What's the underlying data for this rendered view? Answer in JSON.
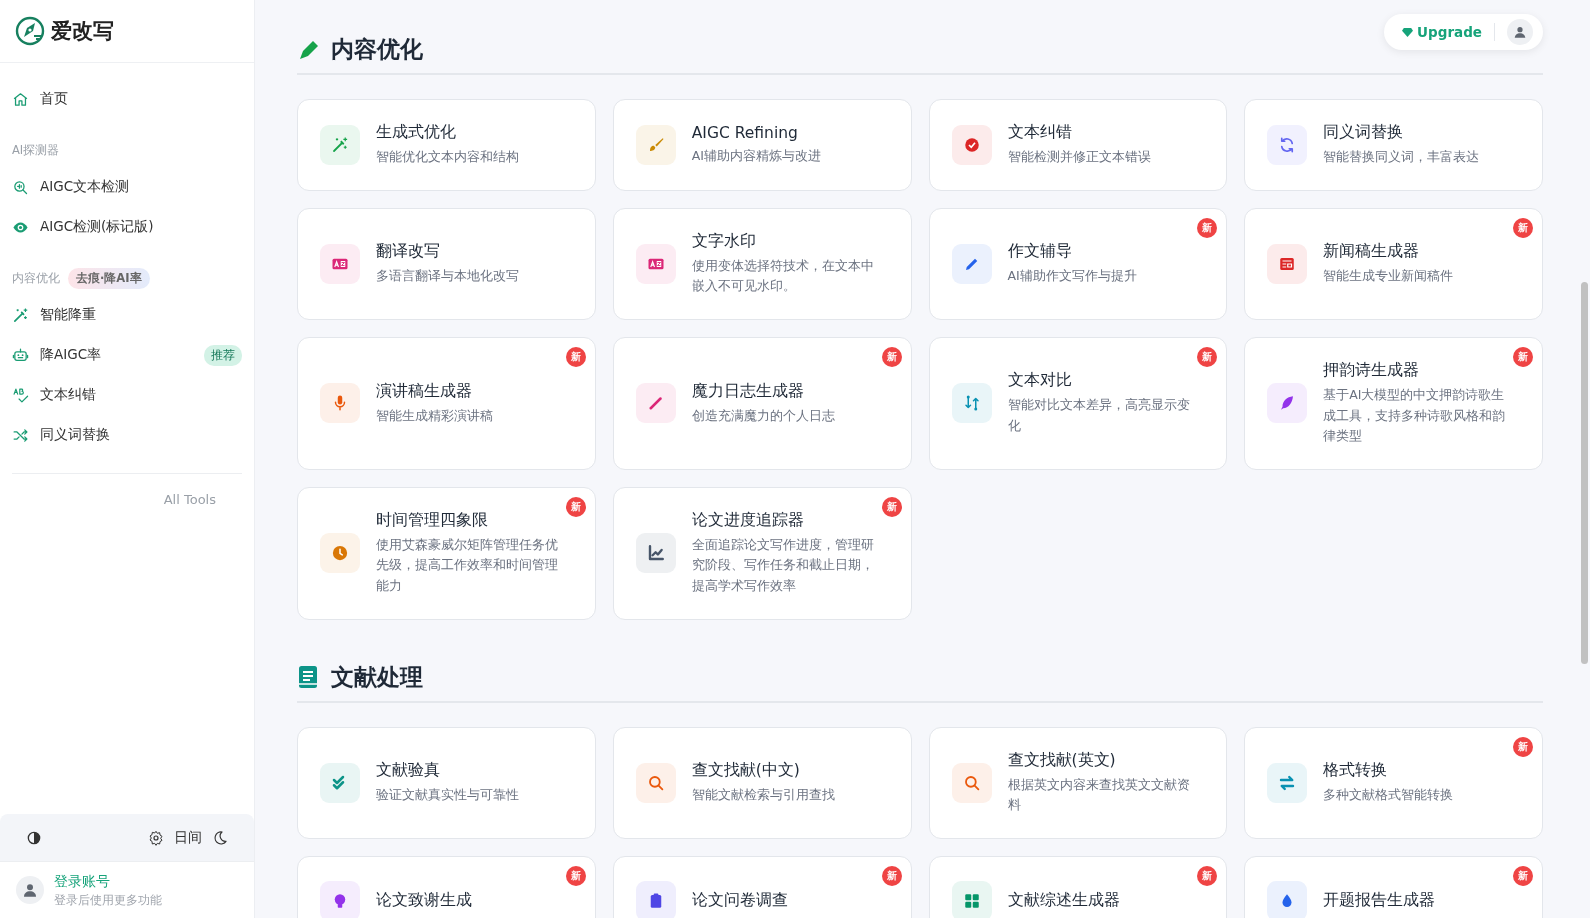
{
  "sidebar": {
    "logo": "爱改写",
    "home": {
      "label": "首页",
      "selected": false
    },
    "groups": [
      {
        "label": "AI探测器",
        "items": [
          {
            "label": "AIGC文本检测",
            "selected": false
          },
          {
            "label": "AIGC检测(标记版)",
            "selected": false
          }
        ]
      },
      {
        "label": "内容优化",
        "tag": "去痕·降AI率",
        "items": [
          {
            "label": "智能降重",
            "selected": false
          },
          {
            "label": "降AIGC率",
            "badge": "推荐",
            "selected": false
          },
          {
            "label": "文本纠错",
            "selected": false
          },
          {
            "label": "同义词替换",
            "selected": false
          }
        ]
      }
    ],
    "all_tools": "All Tools",
    "theme": {
      "label": "日间"
    },
    "account": {
      "name": "登录账号",
      "hint": "登录后使用更多功能"
    }
  },
  "topbar": {
    "upgrade": "Upgrade"
  },
  "sections": [
    {
      "title": "内容优化",
      "cards": [
        {
          "title": "生成式优化",
          "desc": "智能优化文本内容和结构",
          "color": "#16a34a"
        },
        {
          "title": "AIGC Refining",
          "desc": "AI辅助内容精炼与改进",
          "color": "#ca8a04"
        },
        {
          "title": "文本纠错",
          "desc": "智能检测并修正文本错误",
          "color": "#dc2626"
        },
        {
          "title": "同义词替换",
          "desc": "智能替换同义词，丰富表达",
          "color": "#6366f1"
        },
        {
          "title": "翻译改写",
          "desc": "多语言翻译与本地化改写",
          "color": "#db2777"
        },
        {
          "title": "文字水印",
          "desc": "使用变体选择符技术，在文本中嵌入不可见水印。",
          "color": "#db2777"
        },
        {
          "title": "作文辅导",
          "desc": "AI辅助作文写作与提升",
          "badge": "新",
          "color": "#2563eb"
        },
        {
          "title": "新闻稿生成器",
          "desc": "智能生成专业新闻稿件",
          "badge": "新",
          "color": "#dc2626"
        },
        {
          "title": "演讲稿生成器",
          "desc": "智能生成精彩演讲稿",
          "badge": "新",
          "color": "#ea580c"
        },
        {
          "title": "魔力日志生成器",
          "desc": "创造充满魔力的个人日志",
          "badge": "新",
          "color": "#db2777"
        },
        {
          "title": "文本对比",
          "desc": "智能对比文本差异，高亮显示变化",
          "badge": "新",
          "color": "#0891b2"
        },
        {
          "title": "押韵诗生成器",
          "desc": "基于AI大模型的中文押韵诗歌生成工具，支持多种诗歌风格和韵律类型",
          "badge": "新",
          "color": "#9333ea"
        },
        {
          "title": "时间管理四象限",
          "desc": "使用艾森豪威尔矩阵管理任务优先级，提高工作效率和时间管理能力",
          "badge": "新",
          "color": "#d97706"
        },
        {
          "title": "论文进度追踪器",
          "desc": "全面追踪论文写作进度，管理研究阶段、写作任务和截止日期，提高学术写作效率",
          "badge": "新",
          "color": "#475569"
        }
      ]
    },
    {
      "title": "文献处理",
      "cards": [
        {
          "title": "文献验真",
          "desc": "验证文献真实性与可靠性",
          "color": "#0d9488"
        },
        {
          "title": "查文找献(中文)",
          "desc": "智能文献检索与引用查找",
          "color": "#ea580c"
        },
        {
          "title": "查文找献(英文)",
          "desc": "根据英文内容来查找英文文献资料",
          "color": "#ea580c"
        },
        {
          "title": "格式转换",
          "desc": "多种文献格式智能转换",
          "badge": "新",
          "color": "#0891b2"
        },
        {
          "title": "论文致谢生成",
          "badge": "新",
          "color": "#9333ea"
        },
        {
          "title": "论文问卷调查",
          "badge": "新",
          "color": "#4f46e5"
        },
        {
          "title": "文献综述生成器",
          "badge": "新",
          "color": "#059669"
        },
        {
          "title": "开题报告生成器",
          "badge": "新",
          "color": "#2563eb"
        }
      ]
    }
  ]
}
